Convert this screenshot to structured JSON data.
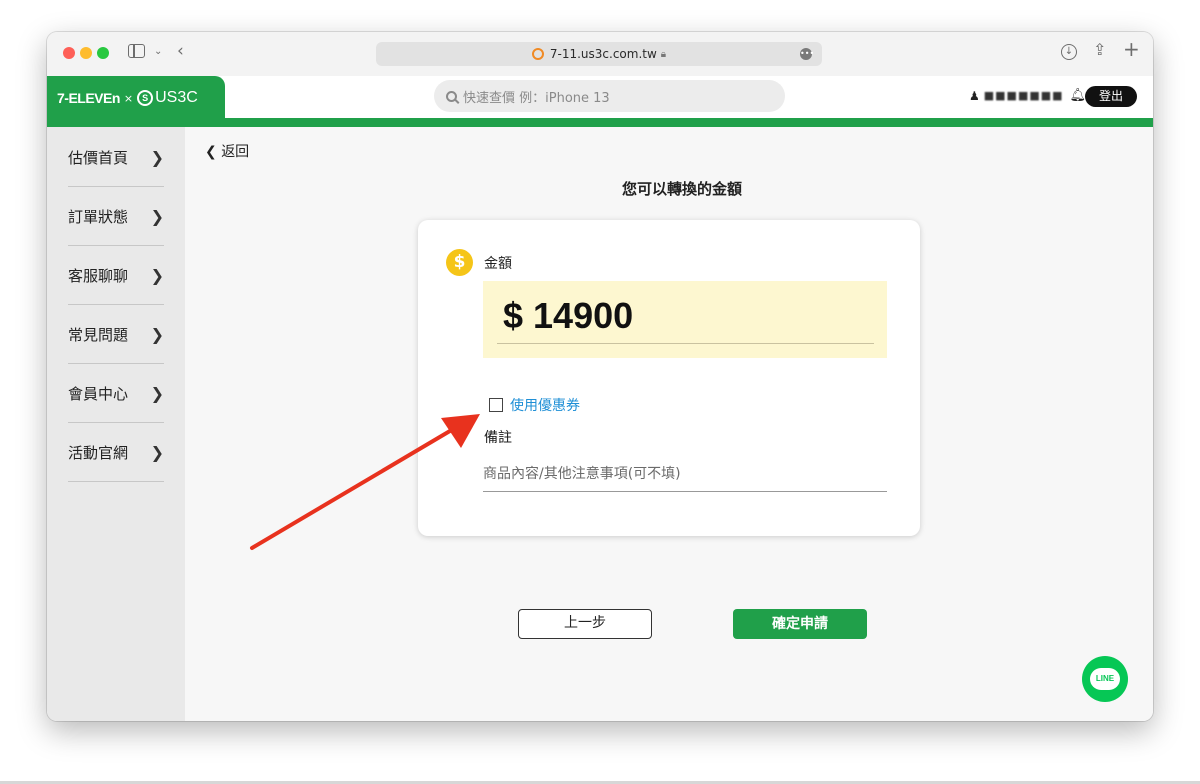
{
  "browser": {
    "url": "7-11.us3c.com.tw"
  },
  "header": {
    "logo_711": "7-ELEVEn",
    "logo_x": "×",
    "logo_us3c": "US3C",
    "search_placeholder": "快速查價 例：iPhone 13",
    "user_name": "■■■■■■■",
    "logout_label": "登出"
  },
  "sidebar": {
    "items": [
      {
        "label": "估價首頁"
      },
      {
        "label": "訂單狀態"
      },
      {
        "label": "客服聊聊"
      },
      {
        "label": "常見問題"
      },
      {
        "label": "會員中心"
      },
      {
        "label": "活動官網"
      }
    ]
  },
  "main": {
    "back_label": "返回",
    "title": "您可以轉換的金額",
    "amount_label": "金額",
    "amount_value": "$ 14900",
    "coupon_label": "使用優惠券",
    "remark_label": "備註",
    "remark_placeholder": "商品內容/其他注意事項(可不填)",
    "prev_label": "上一步",
    "confirm_label": "確定申請"
  },
  "line_button": {
    "label": "LINE"
  },
  "colors": {
    "brand_green": "#20a04a",
    "annotation_arrow": "#e8321e",
    "coin": "#f5c518",
    "amount_bg": "#fdf7d0",
    "link_blue": "#1f8fd6"
  }
}
